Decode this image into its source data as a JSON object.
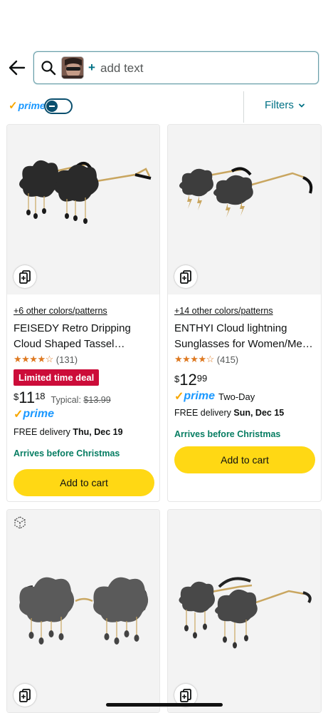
{
  "search": {
    "back_icon": "arrow-left-icon",
    "search_icon": "search-icon",
    "plus": "+",
    "placeholder": "add text"
  },
  "filter_bar": {
    "prime_check": "✓",
    "prime_label": "prime",
    "prime_toggle_on": false,
    "filters_label": "Filters"
  },
  "products": [
    {
      "colors_link": "+6 other colors/patterns",
      "title_line1": "FEISEDY Retro Dripping",
      "title_line2": "Cloud Shaped Tassel…",
      "stars": "★★★★☆",
      "rating": 4.5,
      "rating_count": "(131)",
      "deal_badge": "Limited time deal",
      "price_symbol": "$",
      "price_whole": "11",
      "price_fraction": "18",
      "typical_label": "Typical:",
      "typical_price": "$13.99",
      "prime_label": "prime",
      "delivery_prefix": "FREE delivery",
      "delivery_date": "Thu, Dec 19",
      "christmas": "Arrives before Christmas",
      "cart_label": "Add to cart"
    },
    {
      "colors_link": "+14 other colors/patterns",
      "title_line1": "ENTHYI Cloud lightning",
      "title_line2": "Sunglasses for Women/Me…",
      "stars": "★★★★☆",
      "rating": 4.5,
      "rating_count": "(415)",
      "price_symbol": "$",
      "price_whole": "12",
      "price_fraction": "99",
      "prime_label": "prime",
      "prime_speed": "Two-Day",
      "delivery_prefix": "FREE delivery",
      "delivery_date": "Sun, Dec 15",
      "christmas": "Arrives before Christmas",
      "cart_label": "Add to cart"
    }
  ],
  "colors": {
    "accent": "#007185",
    "prime_blue": "#1a98ff",
    "prime_check": "#f7a600",
    "deal_red": "#cc0c39",
    "christmas_green": "#067d62",
    "cart_yellow": "#ffd814",
    "star_orange": "#de7921"
  }
}
